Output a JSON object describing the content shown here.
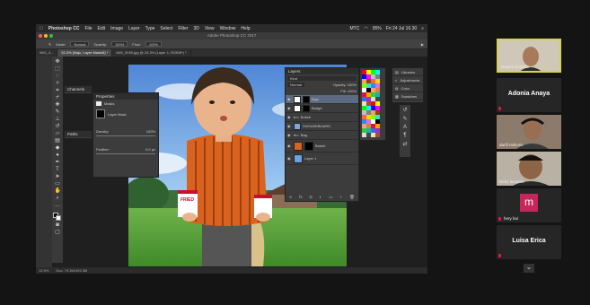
{
  "menubar": {
    "app": "Photoshop CC",
    "items": [
      "File",
      "Edit",
      "Image",
      "Layer",
      "Type",
      "Select",
      "Filter",
      "3D",
      "View",
      "Window",
      "Help"
    ],
    "right": [
      "MTC",
      "95%",
      "Fri 24 Jul 16.30"
    ]
  },
  "window": {
    "title": "Adobe Photoshop CC 2017"
  },
  "options": {
    "mode_label": "Mode:",
    "mode": "Normal",
    "opacity_label": "Opacity:",
    "opacity": "100%",
    "flow_label": "Flow:",
    "flow": "100%"
  },
  "tabs": [
    "IMG_4...",
    "52.3% (Baju, Layer Mask/8) *",
    "IMG_9090.jpg @ 24.3% (Layer 1, RGB/8*) *"
  ],
  "status": {
    "zoom": "12.5%",
    "doc": "Doc: 79.3M/493.3M"
  },
  "properties": {
    "title": "Properties",
    "subtitle": "Masks",
    "layer_mask": "Layer Mask",
    "density_label": "Density:",
    "density": "100%",
    "feather_label": "Feather:",
    "feather": "0.0 px"
  },
  "channels": {
    "title": "Channels"
  },
  "paths": {
    "title": "Paths"
  },
  "layers": {
    "title": "Layers",
    "search": "Kind",
    "blend": "Normal",
    "opacity_label": "Opacity:",
    "opacity": "100%",
    "fill_label": "Fill:",
    "fill": "100%",
    "rows": [
      "Baju",
      "Badge",
      "Bokeh",
      "SHOUSEBOARD",
      "Bag",
      "Bokeh",
      "Layer 1"
    ]
  },
  "rpanel": {
    "items": [
      "Libraries",
      "Adjustments",
      "Color",
      "Swatches"
    ]
  },
  "zoom": {
    "participants": [
      {
        "name": "Boyem Sutanto",
        "type": "video"
      },
      {
        "name": "Adonia Anaya",
        "type": "name"
      },
      {
        "name": "darfil nidvoriv",
        "type": "video"
      },
      {
        "name": "Deny lamaras",
        "type": "video"
      },
      {
        "name": "hery bui",
        "type": "avatar",
        "initial": "m"
      },
      {
        "name": "Luisa Erica",
        "type": "name"
      }
    ],
    "more": "⌄"
  },
  "colors": {
    "accent_active": "#d7d24b",
    "avatar_pink": "#c7265a"
  }
}
